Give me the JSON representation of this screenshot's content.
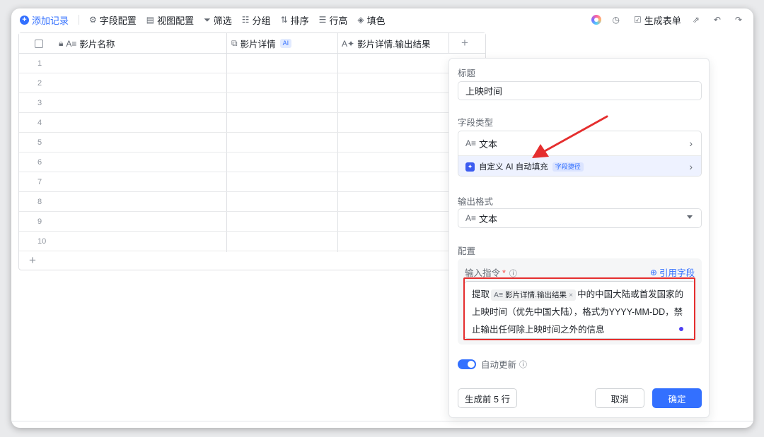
{
  "toolbar": {
    "add_record": "添加记录",
    "field_config": "字段配置",
    "view_config": "视图配置",
    "filter": "筛选",
    "group": "分组",
    "sort": "排序",
    "row_height": "行高",
    "fill_color": "填色",
    "generate_form": "生成表单"
  },
  "table": {
    "columns": [
      {
        "label": "影片名称",
        "icon": "text-field-icon",
        "prefix_icon": "lock-icon"
      },
      {
        "label": "影片详情",
        "icon": "ai-field-icon",
        "badge": "AI"
      },
      {
        "label": "影片详情.输出结果",
        "icon": "text-ai-field-icon"
      }
    ],
    "rows": [
      "1",
      "2",
      "3",
      "4",
      "5",
      "6",
      "7",
      "8",
      "9",
      "10"
    ]
  },
  "panel": {
    "title_label": "标题",
    "title_value": "上映时间",
    "field_type_label": "字段类型",
    "field_type_text": "文本",
    "field_type_ai": "自定义 AI 自动填充",
    "field_type_ai_badge": "字段捷径",
    "output_format_label": "输出格式",
    "output_format_value": "文本",
    "config_label": "配置",
    "prompt_label": "输入指令",
    "prompt_required": "*",
    "ref_field": "引用字段",
    "prompt_prefix": "提取",
    "prompt_chip": "影片详情.输出结果",
    "prompt_suffix": "中的中国大陆或首发国家的上映时间（优先中国大陆），格式为YYYY-MM-DD，禁止输出任何除上映时间之外的信息",
    "auto_update": "自动更新",
    "btn_generate": "生成前 5 行",
    "btn_cancel": "取消",
    "btn_ok": "确定"
  },
  "colors": {
    "accent": "#3370ff",
    "highlight_red": "#e52e2e"
  }
}
